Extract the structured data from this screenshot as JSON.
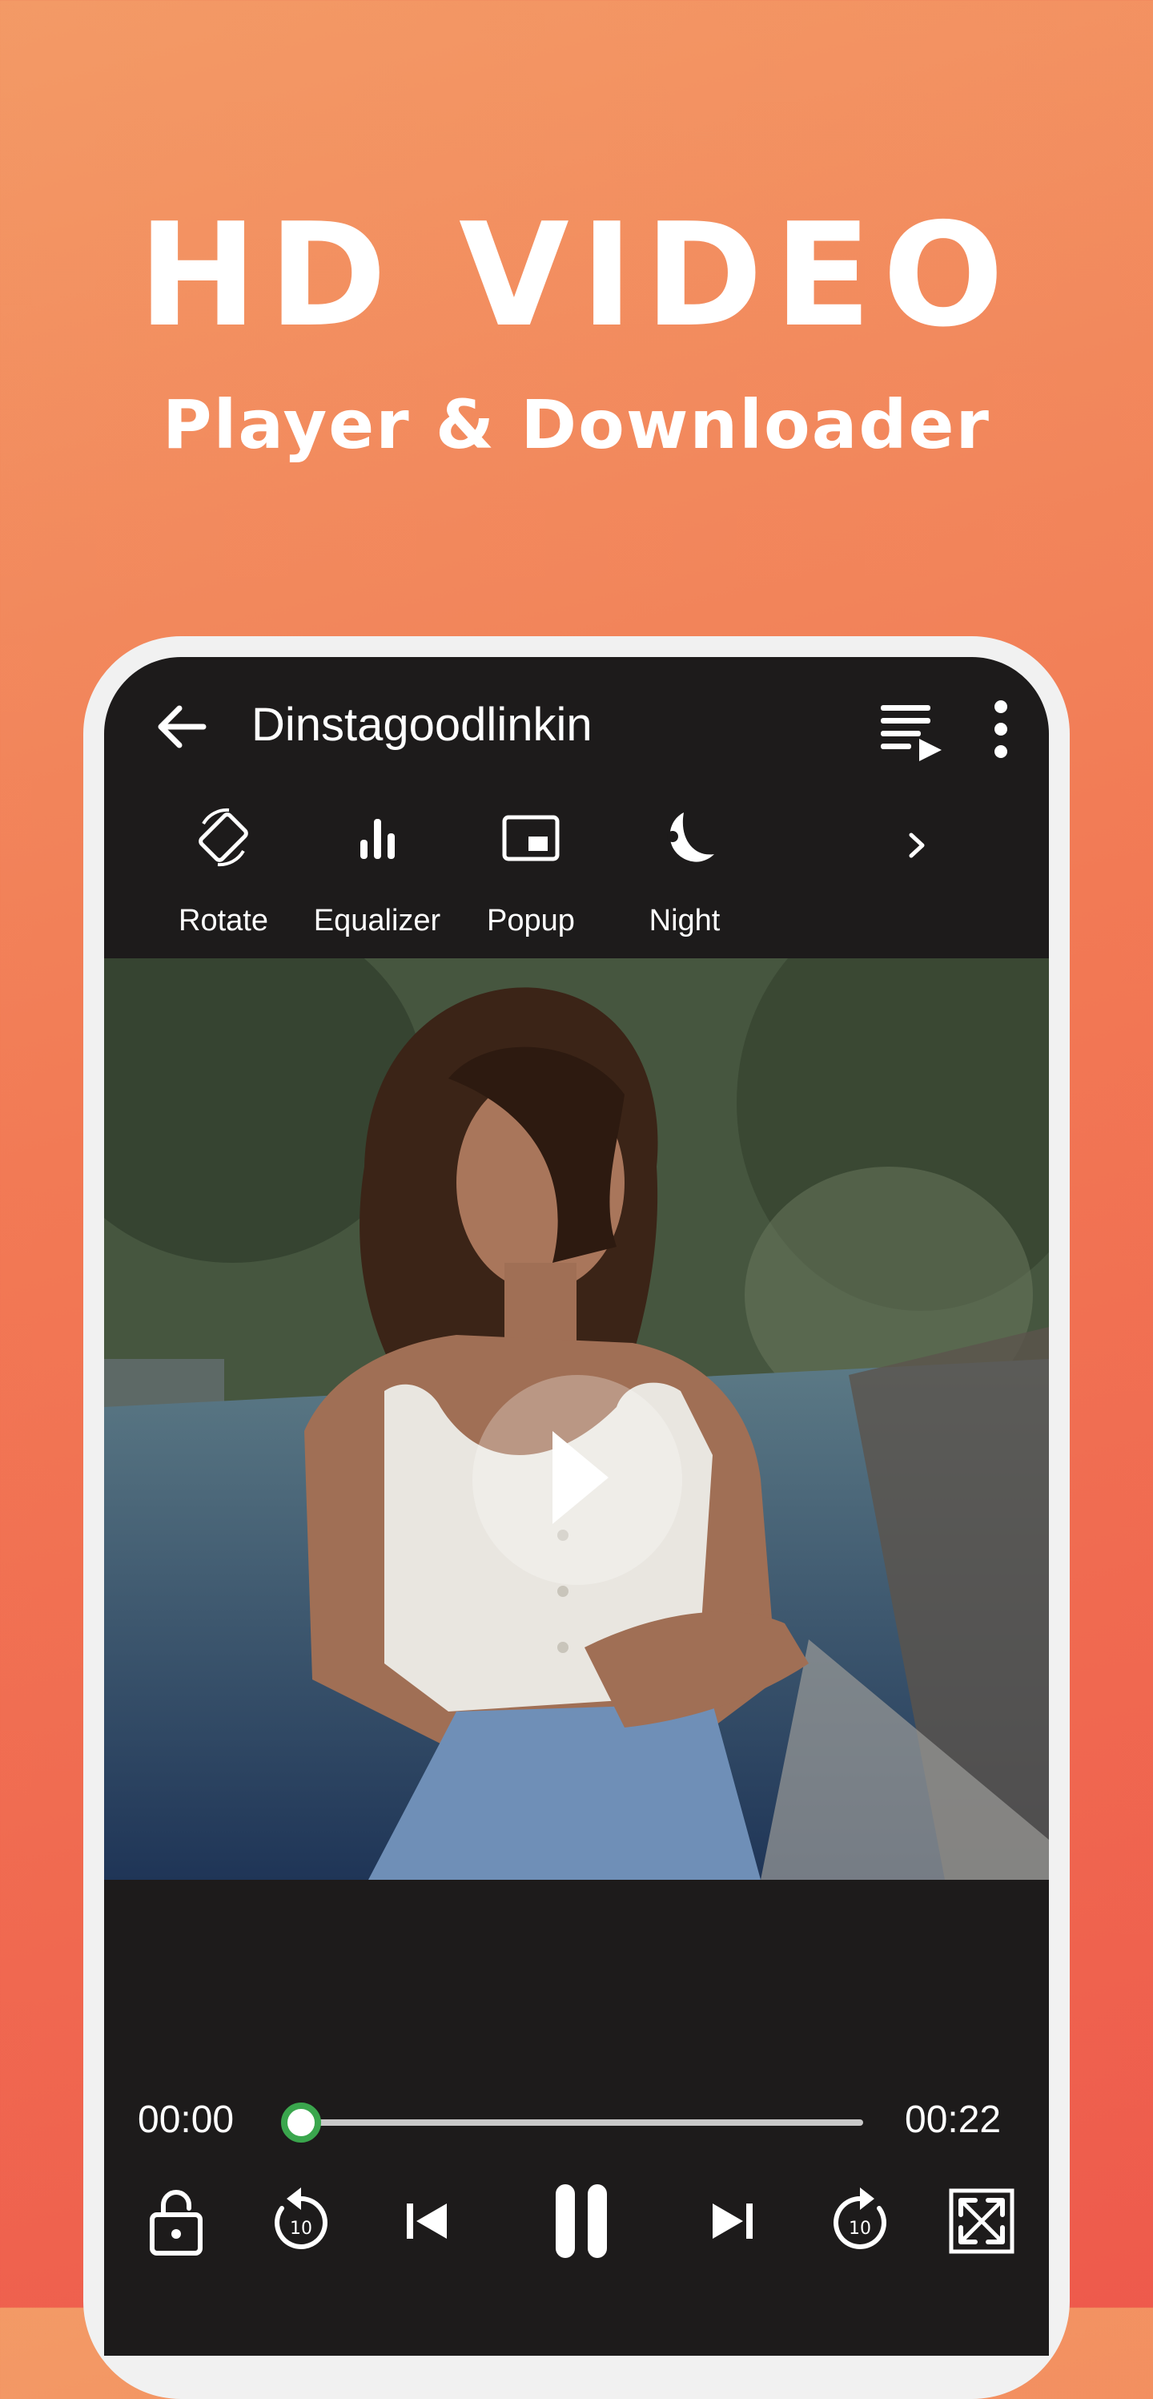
{
  "promo": {
    "headline": "HD VIDEO",
    "subheadline": "Player & Downloader"
  },
  "player": {
    "title": "Dinstagoodlinkin",
    "tools": [
      {
        "label": "Rotate",
        "icon": "rotate-icon"
      },
      {
        "label": "Equalizer",
        "icon": "equalizer-icon"
      },
      {
        "label": "Popup",
        "icon": "popup-icon"
      },
      {
        "label": "Night",
        "icon": "night-mode-icon"
      }
    ],
    "time_current": "00:00",
    "time_total": "00:22",
    "progress_fraction": 0,
    "replay_seconds": "10",
    "forward_seconds": "10",
    "controls": [
      "lock-icon",
      "replay-10-icon",
      "skip-previous-icon",
      "pause-icon",
      "skip-next-icon",
      "forward-10-icon",
      "fullscreen-icon"
    ]
  },
  "colors": {
    "background_top": "#f39a66",
    "background_bottom": "#ee5a4c",
    "player_background": "#1d1b1b",
    "seek_accent": "#3aa64d",
    "seek_track": "#c9c9c9"
  }
}
